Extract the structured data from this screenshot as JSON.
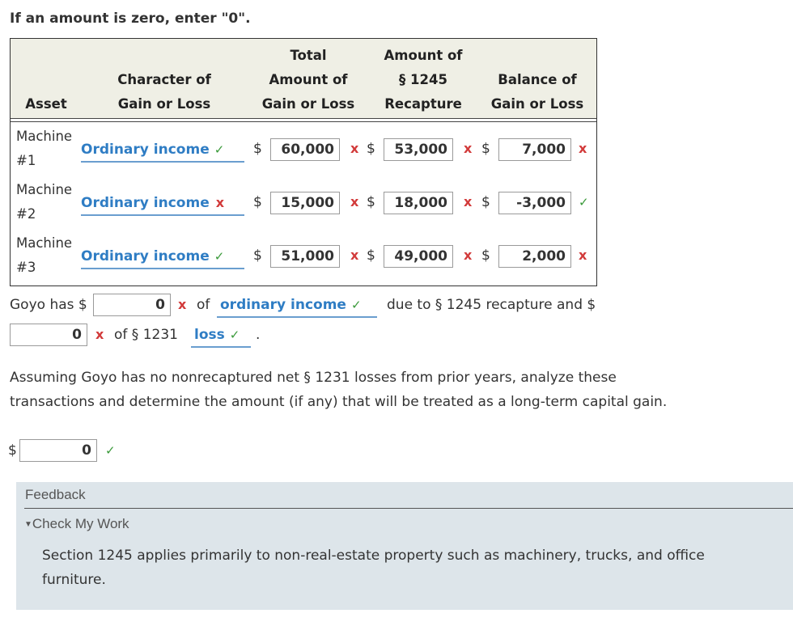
{
  "instruction": "If an amount is zero, enter \"0\".",
  "table": {
    "headers": {
      "asset": "Asset",
      "character_line1": "Character of",
      "character_line2": "Gain or Loss",
      "total_line1": "Total",
      "total_line2": "Amount of",
      "total_line3": "Gain or Loss",
      "recapture_line1": "Amount of",
      "recapture_line2": "§ 1245",
      "recapture_line3": "Recapture",
      "balance_line1": "Balance of",
      "balance_line2": "Gain or Loss"
    },
    "rows": [
      {
        "asset_line1": "Machine",
        "asset_line2": "#1",
        "character": "Ordinary income",
        "character_mark": "✓",
        "total": "60,000",
        "total_mark": "x",
        "recapture": "53,000",
        "recapture_mark": "x",
        "balance": "7,000",
        "balance_mark": "x"
      },
      {
        "asset_line1": "Machine",
        "asset_line2": "#2",
        "character": "Ordinary income",
        "character_mark": "x",
        "total": "15,000",
        "total_mark": "x",
        "recapture": "18,000",
        "recapture_mark": "x",
        "balance": "-3,000",
        "balance_mark": "✓"
      },
      {
        "asset_line1": "Machine",
        "asset_line2": "#3",
        "character": "Ordinary income",
        "character_mark": "✓",
        "total": "51,000",
        "total_mark": "x",
        "recapture": "49,000",
        "recapture_mark": "x",
        "balance": "2,000",
        "balance_mark": "x"
      }
    ]
  },
  "dollar_sign": "$",
  "sentence": {
    "prefix": "Goyo has $",
    "amount1": "0",
    "amount1_mark": "x",
    "of_text": "of",
    "select1": "ordinary income",
    "select1_mark": "✓",
    "middle": "due to § 1245 recapture and $",
    "amount2": "0",
    "amount2_mark": "x",
    "of_1231": "of § 1231",
    "select2": "loss",
    "select2_mark": "✓",
    "end": "."
  },
  "question": "Assuming Goyo has no nonrecaptured net § 1231 losses from prior years, analyze these transactions and determine the amount (if any) that will be treated as a long-term capital gain.",
  "answer": {
    "value": "0",
    "mark": "✓"
  },
  "feedback": {
    "title": "Feedback",
    "toggle": "Check My Work",
    "text": "Section 1245 applies primarily to non-real-estate property such as machinery, trucks, and office furniture."
  },
  "colors": {
    "correct": "#3a9a3a",
    "incorrect": "#d23a3a",
    "select_text": "#2f7dc4",
    "header_bg": "#efefe5",
    "feedback_bg": "#dde5ea"
  }
}
